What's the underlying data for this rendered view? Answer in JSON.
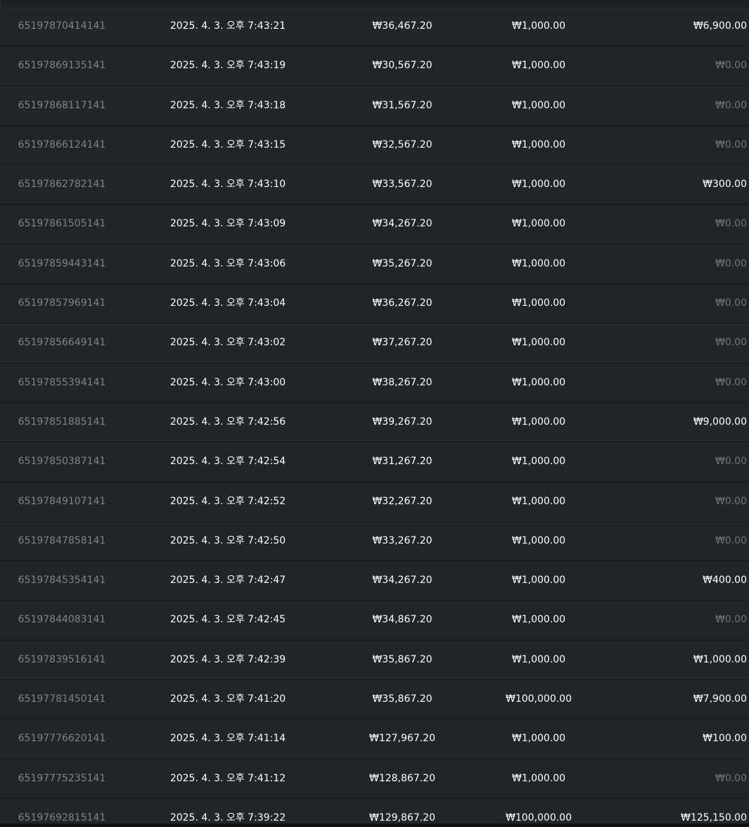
{
  "table": {
    "rows": [
      {
        "id": "65197870414141",
        "time": "2025. 4. 3. 오후 7:43:21",
        "balance": "₩36,467.20",
        "bet": "₩1,000.00",
        "win": "₩6,900.00",
        "win_zero": false
      },
      {
        "id": "65197869135141",
        "time": "2025. 4. 3. 오후 7:43:19",
        "balance": "₩30,567.20",
        "bet": "₩1,000.00",
        "win": "₩0.00",
        "win_zero": true
      },
      {
        "id": "65197868117141",
        "time": "2025. 4. 3. 오후 7:43:18",
        "balance": "₩31,567.20",
        "bet": "₩1,000.00",
        "win": "₩0.00",
        "win_zero": true
      },
      {
        "id": "65197866124141",
        "time": "2025. 4. 3. 오후 7:43:15",
        "balance": "₩32,567.20",
        "bet": "₩1,000.00",
        "win": "₩0.00",
        "win_zero": true
      },
      {
        "id": "65197862782141",
        "time": "2025. 4. 3. 오후 7:43:10",
        "balance": "₩33,567.20",
        "bet": "₩1,000.00",
        "win": "₩300.00",
        "win_zero": false
      },
      {
        "id": "65197861505141",
        "time": "2025. 4. 3. 오후 7:43:09",
        "balance": "₩34,267.20",
        "bet": "₩1,000.00",
        "win": "₩0.00",
        "win_zero": true
      },
      {
        "id": "65197859443141",
        "time": "2025. 4. 3. 오후 7:43:06",
        "balance": "₩35,267.20",
        "bet": "₩1,000.00",
        "win": "₩0.00",
        "win_zero": true
      },
      {
        "id": "65197857969141",
        "time": "2025. 4. 3. 오후 7:43:04",
        "balance": "₩36,267.20",
        "bet": "₩1,000.00",
        "win": "₩0.00",
        "win_zero": true
      },
      {
        "id": "65197856649141",
        "time": "2025. 4. 3. 오후 7:43:02",
        "balance": "₩37,267.20",
        "bet": "₩1,000.00",
        "win": "₩0.00",
        "win_zero": true
      },
      {
        "id": "65197855394141",
        "time": "2025. 4. 3. 오후 7:43:00",
        "balance": "₩38,267.20",
        "bet": "₩1,000.00",
        "win": "₩0.00",
        "win_zero": true
      },
      {
        "id": "65197851885141",
        "time": "2025. 4. 3. 오후 7:42:56",
        "balance": "₩39,267.20",
        "bet": "₩1,000.00",
        "win": "₩9,000.00",
        "win_zero": false
      },
      {
        "id": "65197850387141",
        "time": "2025. 4. 3. 오후 7:42:54",
        "balance": "₩31,267.20",
        "bet": "₩1,000.00",
        "win": "₩0.00",
        "win_zero": true
      },
      {
        "id": "65197849107141",
        "time": "2025. 4. 3. 오후 7:42:52",
        "balance": "₩32,267.20",
        "bet": "₩1,000.00",
        "win": "₩0.00",
        "win_zero": true
      },
      {
        "id": "65197847858141",
        "time": "2025. 4. 3. 오후 7:42:50",
        "balance": "₩33,267.20",
        "bet": "₩1,000.00",
        "win": "₩0.00",
        "win_zero": true
      },
      {
        "id": "65197845354141",
        "time": "2025. 4. 3. 오후 7:42:47",
        "balance": "₩34,267.20",
        "bet": "₩1,000.00",
        "win": "₩400.00",
        "win_zero": false
      },
      {
        "id": "65197844083141",
        "time": "2025. 4. 3. 오후 7:42:45",
        "balance": "₩34,867.20",
        "bet": "₩1,000.00",
        "win": "₩0.00",
        "win_zero": true
      },
      {
        "id": "65197839516141",
        "time": "2025. 4. 3. 오후 7:42:39",
        "balance": "₩35,867.20",
        "bet": "₩1,000.00",
        "win": "₩1,000.00",
        "win_zero": false
      },
      {
        "id": "65197781450141",
        "time": "2025. 4. 3. 오후 7:41:20",
        "balance": "₩35,867.20",
        "bet": "₩100,000.00",
        "win": "₩7,900.00",
        "win_zero": false
      },
      {
        "id": "65197776620141",
        "time": "2025. 4. 3. 오후 7:41:14",
        "balance": "₩127,967.20",
        "bet": "₩1,000.00",
        "win": "₩100.00",
        "win_zero": false
      },
      {
        "id": "65197775235141",
        "time": "2025. 4. 3. 오후 7:41:12",
        "balance": "₩128,867.20",
        "bet": "₩1,000.00",
        "win": "₩0.00",
        "win_zero": true
      },
      {
        "id": "65197692815141",
        "time": "2025. 4. 3. 오후 7:39:22",
        "balance": "₩129,867.20",
        "bet": "₩100,000.00",
        "win": "₩125,150.00",
        "win_zero": false
      }
    ],
    "colors": {
      "background": "#202629",
      "id_text": "#7d858b",
      "primary_text": "#ffffff",
      "zero_text": "#6f767b"
    }
  }
}
